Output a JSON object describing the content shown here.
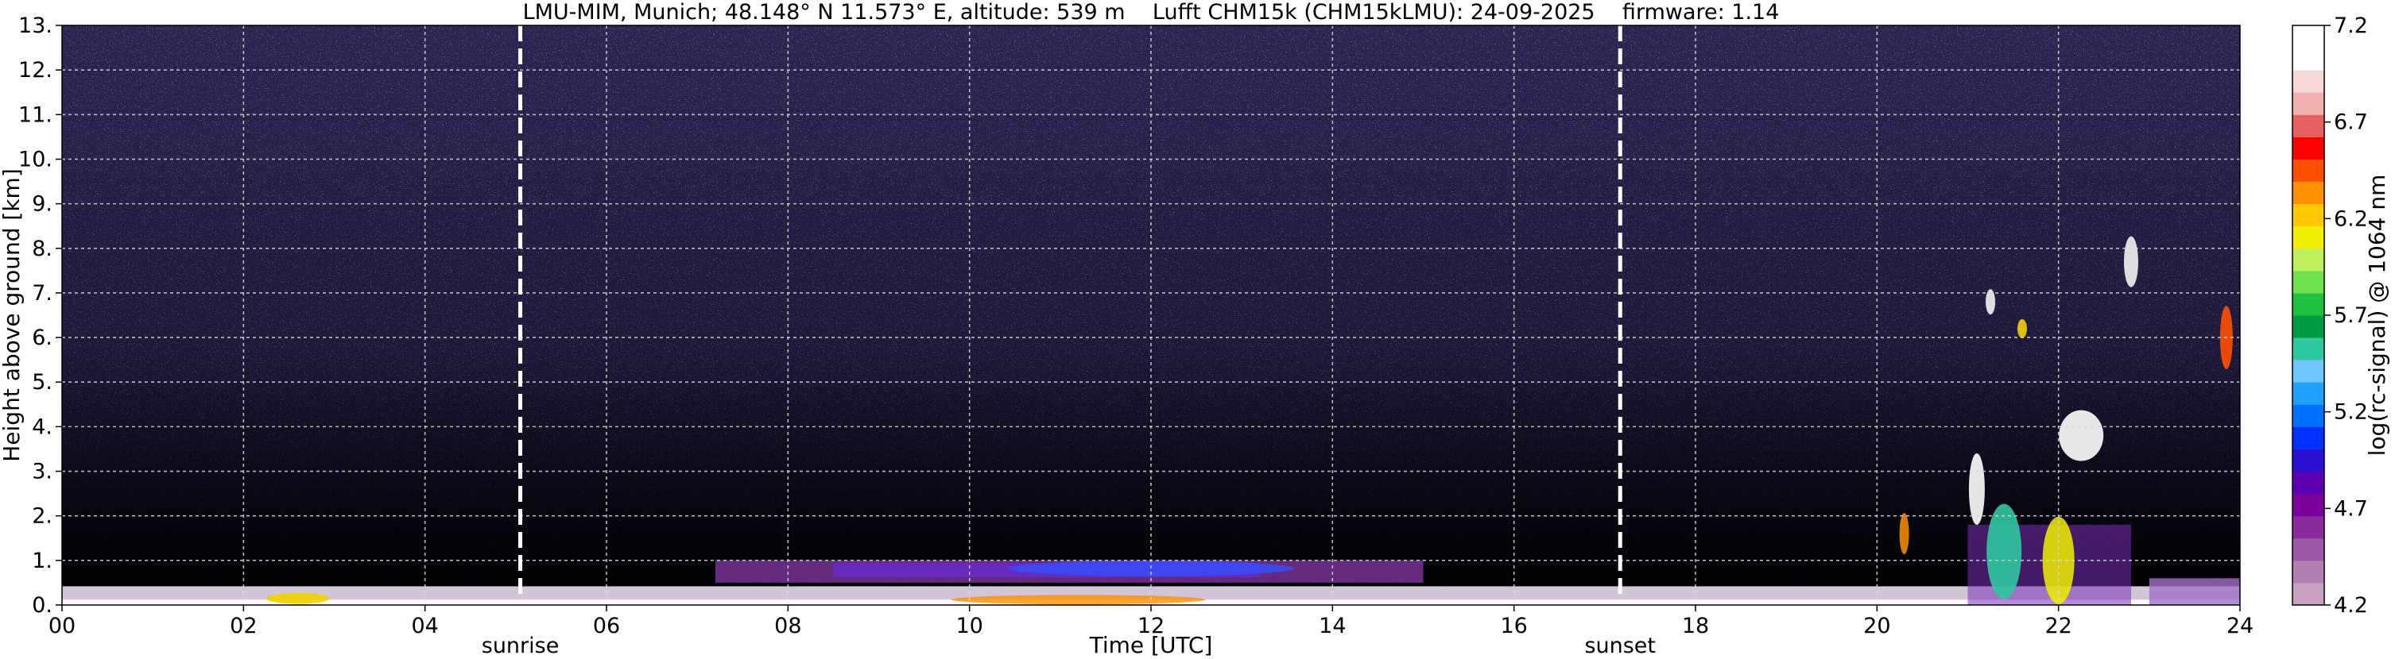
{
  "chart_data": {
    "type": "heatmap",
    "title": "LMU-MIM, Munich; 48.148° N 11.573° E, altitude: 539 m    Lufft CHM15k (CHM15kLMU): 24-09-2025    firmware: 1.14",
    "xlabel": "Time [UTC]",
    "ylabel": "Height above ground [km]",
    "xlim": [
      0,
      24
    ],
    "ylim": [
      0,
      13
    ],
    "x_ticks": [
      "00",
      "02",
      "04",
      "06",
      "08",
      "10",
      "12",
      "14",
      "16",
      "18",
      "20",
      "22",
      "24"
    ],
    "y_ticks": [
      "0.",
      "1.",
      "2.",
      "3.",
      "4.",
      "5.",
      "6.",
      "7.",
      "8.",
      "9.",
      "10.",
      "11.",
      "12.",
      "13."
    ],
    "grid": true,
    "colorbar": {
      "label": "log(rc-signal) @ 1064 nm",
      "range": [
        4.2,
        7.2
      ],
      "tick_values": [
        4.2,
        4.7,
        5.2,
        5.7,
        6.2,
        6.7,
        7.2
      ],
      "tick_labels": [
        "4.2",
        "4.7",
        "5.2",
        "5.7",
        "6.2",
        "6.7",
        "7.2"
      ],
      "colors": [
        "#c8a0c0",
        "#b080b0",
        "#9a5aa8",
        "#8a2a9c",
        "#7a009a",
        "#5a00b0",
        "#2a10d0",
        "#0030ff",
        "#0070ff",
        "#20a0ff",
        "#70c8ff",
        "#30c8a0",
        "#009a40",
        "#20c040",
        "#70e050",
        "#c0f060",
        "#f0f000",
        "#ffc800",
        "#ff9000",
        "#ff5000",
        "#ff0000",
        "#e86060",
        "#f0b0b0",
        "#f6d8d8",
        "#ffffff",
        "#ffffff"
      ]
    },
    "annotations": [
      {
        "text": "sunrise",
        "x": 5.05
      },
      {
        "text": "sunset",
        "x": 17.17
      }
    ]
  }
}
